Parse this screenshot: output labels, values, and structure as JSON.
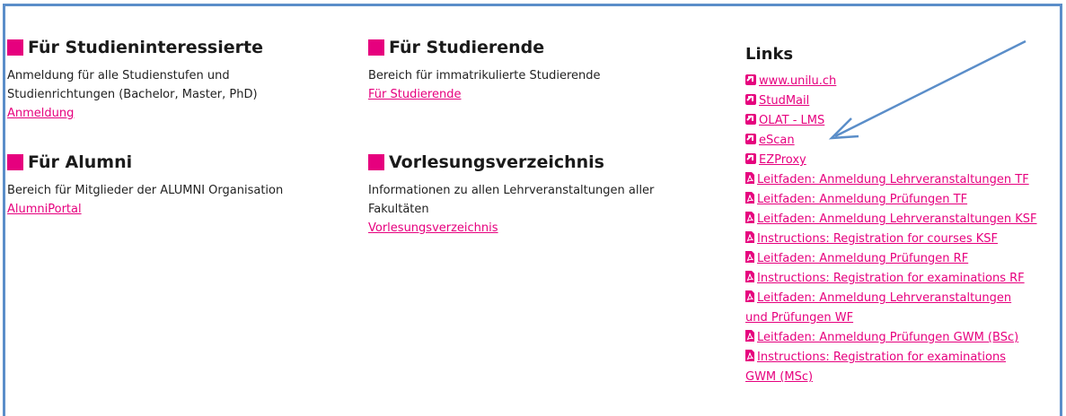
{
  "sections": {
    "studieninteressierte": {
      "title": "Für Studieninteressierte",
      "description_line1": "Anmeldung für alle Studienstufen und",
      "description_line2": "Studienrichtungen (Bachelor, Master, PhD)",
      "link": "Anmeldung"
    },
    "alumni": {
      "title": "Für Alumni",
      "description": "Bereich für Mitglieder der ALUMNI Organisation",
      "link": "AlumniPortal"
    },
    "studierende": {
      "title": "Für Studierende",
      "description": "Bereich für immatrikulierte Studierende",
      "link": "Für Studierende"
    },
    "vorlesungsverzeichnis": {
      "title": "Vorlesungsverzeichnis",
      "description_line1": "Informationen zu allen Lehrveranstaltungen aller",
      "description_line2": "Fakultäten",
      "link": "Vorlesungsverzeichnis"
    }
  },
  "links": {
    "title": "Links",
    "items": [
      {
        "label": "www.unilu.ch",
        "icon": "external-link-icon"
      },
      {
        "label": "StudMail",
        "icon": "external-link-icon"
      },
      {
        "label": "OLAT - LMS",
        "icon": "external-link-icon"
      },
      {
        "label": "eScan",
        "icon": "external-link-icon"
      },
      {
        "label": "EZProxy",
        "icon": "external-link-icon"
      },
      {
        "label": "Leitfaden: Anmeldung Lehrveranstaltungen TF",
        "icon": "pdf-icon"
      },
      {
        "label": "Leitfaden: Anmeldung Prüfungen TF",
        "icon": "pdf-icon"
      },
      {
        "label": "Leitfaden: Anmeldung Lehrveranstaltungen KSF",
        "icon": "pdf-icon"
      },
      {
        "label": "Instructions: Registration for courses KSF",
        "icon": "pdf-icon"
      },
      {
        "label": "Leitfaden: Anmeldung Prüfungen RF",
        "icon": "pdf-icon"
      },
      {
        "label": "Instructions: Registration for examinations RF",
        "icon": "pdf-icon"
      },
      {
        "label_line1": "Leitfaden: Anmeldung Lehrveranstaltungen",
        "label_line2": "und Prüfungen WF",
        "icon": "pdf-icon"
      },
      {
        "label": "Leitfaden: Anmeldung Prüfungen GWM (BSc)",
        "icon": "pdf-icon"
      },
      {
        "label_line1": "Instructions: Registration for examinations",
        "label_line2": "GWM (MSc)",
        "icon": "pdf-icon"
      }
    ]
  },
  "colors": {
    "accent": "#e6007e",
    "frame": "#5b8ec9",
    "annotation_arrow": "#5b8ec9"
  }
}
